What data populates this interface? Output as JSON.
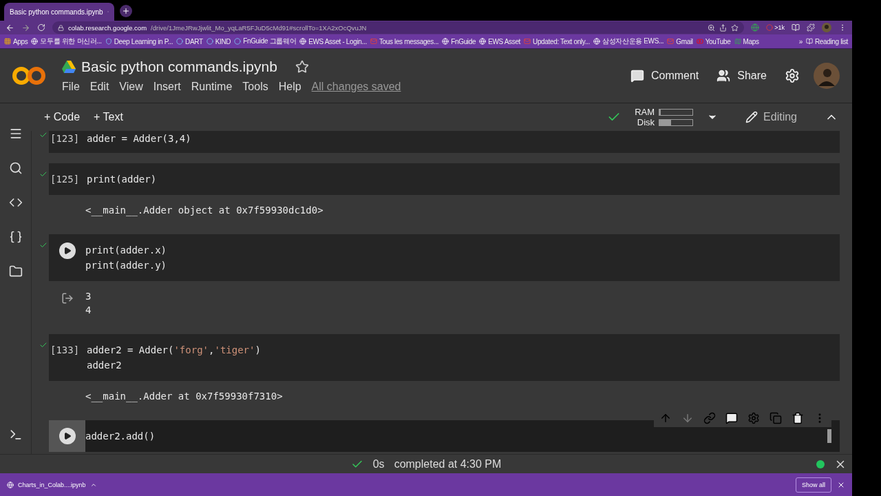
{
  "browser": {
    "tab": {
      "title": "Basic python commands.ipynb",
      "selected": true
    },
    "url": {
      "host": "colab.research.google.com",
      "path": "/drive/1JmeJRwJjwlit_Mo_yqLaR5FJuD5cMd91#scrollTo=1XA2xOcQvuJN"
    },
    "bookmarks": [
      {
        "label": "Apps",
        "kind": "apps"
      },
      {
        "label": "모두를 위한 머신러...",
        "kind": "globe"
      },
      {
        "label": "Deep Learning in P...",
        "kind": "shield"
      },
      {
        "label": "DART",
        "kind": "site"
      },
      {
        "label": "KIND",
        "kind": "site"
      },
      {
        "label": "FnGuide 그룹웨어",
        "kind": "site"
      },
      {
        "label": "EWS Asset - Login...",
        "kind": "globe"
      },
      {
        "label": "Tous les messages...",
        "kind": "mail"
      },
      {
        "label": "FnGuide",
        "kind": "globe"
      },
      {
        "label": "EWS Asset",
        "kind": "globe"
      },
      {
        "label": "Updated: Text only...",
        "kind": "mail"
      },
      {
        "label": "삼성자산운용 EWS...",
        "kind": "globe"
      },
      {
        "label": "Gmail",
        "kind": "mail"
      },
      {
        "label": "YouTube",
        "kind": "video"
      },
      {
        "label": "Maps",
        "kind": "map"
      }
    ],
    "more": "»",
    "reading_list": "Reading list",
    "extension_badge": ">1k"
  },
  "colab": {
    "title": "Basic python commands.ipynb",
    "starred": false,
    "menu": [
      "File",
      "Edit",
      "View",
      "Insert",
      "Runtime",
      "Tools",
      "Help"
    ],
    "save_status": "All changes saved",
    "comment": "Comment",
    "share": "Share",
    "add_buttons": [
      "+ Code",
      "+ Text"
    ],
    "resources": [
      {
        "label": "RAM",
        "level": 0.05
      },
      {
        "label": "Disk",
        "level": 0.35
      }
    ],
    "editing": "Editing"
  },
  "cells": [
    {
      "prompt": "[123]",
      "executed": true,
      "selected": false,
      "lines": [
        "adder = Adder(3,4)"
      ]
    },
    {
      "prompt": "[125]",
      "executed": true,
      "selected": false,
      "lines": [
        "print(adder)"
      ],
      "output_icon": false,
      "output": [
        "<__main__.Adder object at 0x7f59930dc1d0>"
      ]
    },
    {
      "executed": true,
      "selected": false,
      "lines": [
        "print(adder.x)",
        "print(adder.y)"
      ],
      "output_icon": true,
      "output": [
        "3",
        "4"
      ]
    },
    {
      "prompt": "[133]",
      "executed": true,
      "selected": false,
      "output_icon": false,
      "lines": [
        [
          {
            "text": "adder2 = Adder(",
            "kind": "plain"
          },
          {
            "text": "'forg'",
            "kind": "string"
          },
          {
            "text": ",",
            "kind": "plain"
          },
          {
            "text": "'tiger'",
            "kind": "string"
          },
          {
            "text": ")",
            "kind": "plain"
          }
        ],
        "adder2"
      ],
      "output": [
        "<__main__.Adder at 0x7f59930f7310>"
      ]
    },
    {
      "executed": false,
      "selected": true,
      "lines": [
        "adder2.add()"
      ]
    }
  ],
  "status_bar": {
    "time": "0s",
    "message": "completed at 4:30 PM",
    "connected": true
  },
  "downloads": {
    "file": "Charts_in_Colab....ipynb",
    "show_all": "Show all"
  }
}
